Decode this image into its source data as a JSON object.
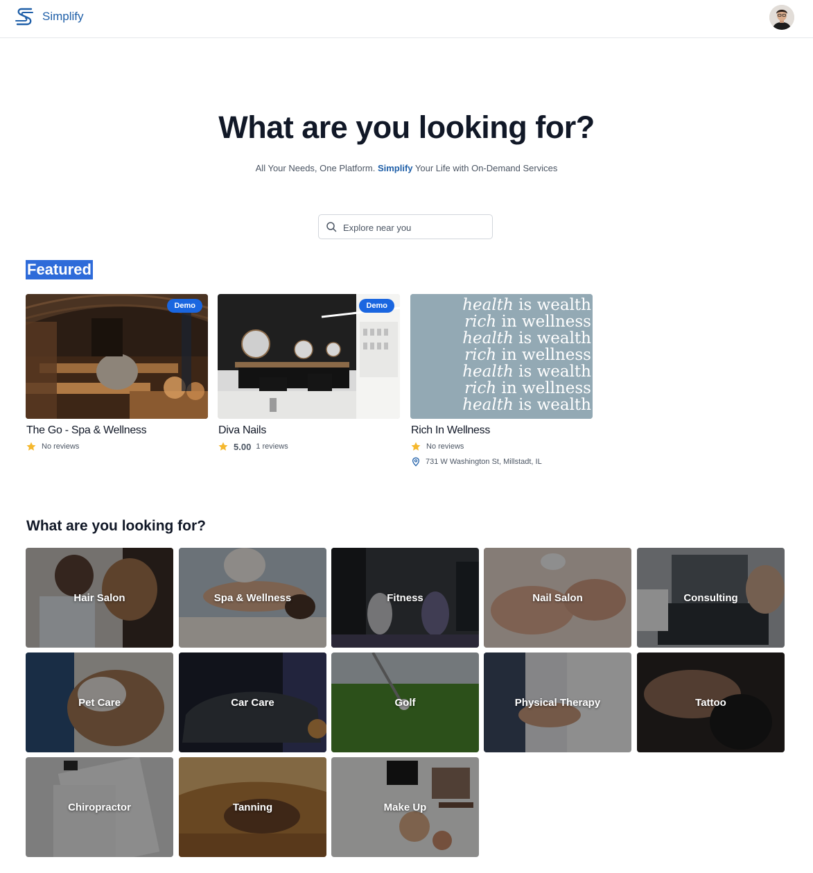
{
  "header": {
    "brand": "Simplify",
    "brand_color": "#1f5fa8",
    "logo_icon": "simplify-s-logo",
    "avatar_icon": "user-avatar"
  },
  "hero": {
    "title": "What are you looking for?",
    "subtitle_before": "All Your Needs, One Platform. ",
    "subtitle_accent": "Simplify",
    "subtitle_after": " Your Life with On-Demand Services"
  },
  "search": {
    "placeholder": "Explore near you",
    "value": "",
    "icon": "search-icon"
  },
  "featured": {
    "title": "Featured",
    "items": [
      {
        "name": "The Go - Spa & Wellness",
        "badge": "Demo",
        "rating": "",
        "reviews": "No reviews",
        "address": ""
      },
      {
        "name": "Diva Nails",
        "badge": "Demo",
        "rating": "5.00",
        "reviews": "1 reviews",
        "address": ""
      },
      {
        "name": "Rich In Wellness",
        "badge": "",
        "rating": "",
        "reviews": "No reviews",
        "address": "731 W Washington St, Millstadt, IL",
        "image_text": [
          "health",
          "is wealth",
          "rich",
          "in wellness"
        ]
      }
    ]
  },
  "categories": {
    "title": "What are you looking for?",
    "items": [
      "Hair Salon",
      "Spa & Wellness",
      "Fitness",
      "Nail Salon",
      "Consulting",
      "Pet Care",
      "Car Care",
      "Golf",
      "Physical Therapy",
      "Tattoo",
      "Chiropractor",
      "Tanning",
      "Make Up"
    ]
  },
  "colors": {
    "accent": "#1f5fa8",
    "badge": "#1a66e0",
    "star": "#f5b82e",
    "featured_highlight": "#2e6bd9"
  }
}
